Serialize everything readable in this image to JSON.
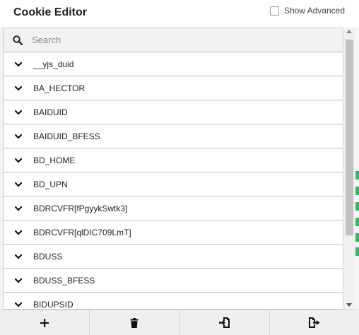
{
  "header": {
    "title": "Cookie Editor",
    "show_advanced_label": "Show Advanced",
    "show_advanced_checked": false
  },
  "search": {
    "placeholder": "Search"
  },
  "cookies": [
    "__yjs_duid",
    "BA_HECTOR",
    "BAIDUID",
    "BAIDUID_BFESS",
    "BD_HOME",
    "BD_UPN",
    "BDRCVFR[fPgyykSwtk3]",
    "BDRCVFR[qlDIC709LmT]",
    "BDUSS",
    "BDUSS_BFESS",
    "BIDUPSID"
  ],
  "toolbar": {
    "buttons": [
      {
        "icon": "plus-icon",
        "action": "add"
      },
      {
        "icon": "trash-icon",
        "action": "delete"
      },
      {
        "icon": "import-icon",
        "action": "import"
      },
      {
        "icon": "export-icon",
        "action": "export"
      }
    ]
  },
  "colors": {
    "accent_green": "#1ec45a",
    "search_bg": "#f2f2f2",
    "toolbar_bg": "#efefef"
  }
}
